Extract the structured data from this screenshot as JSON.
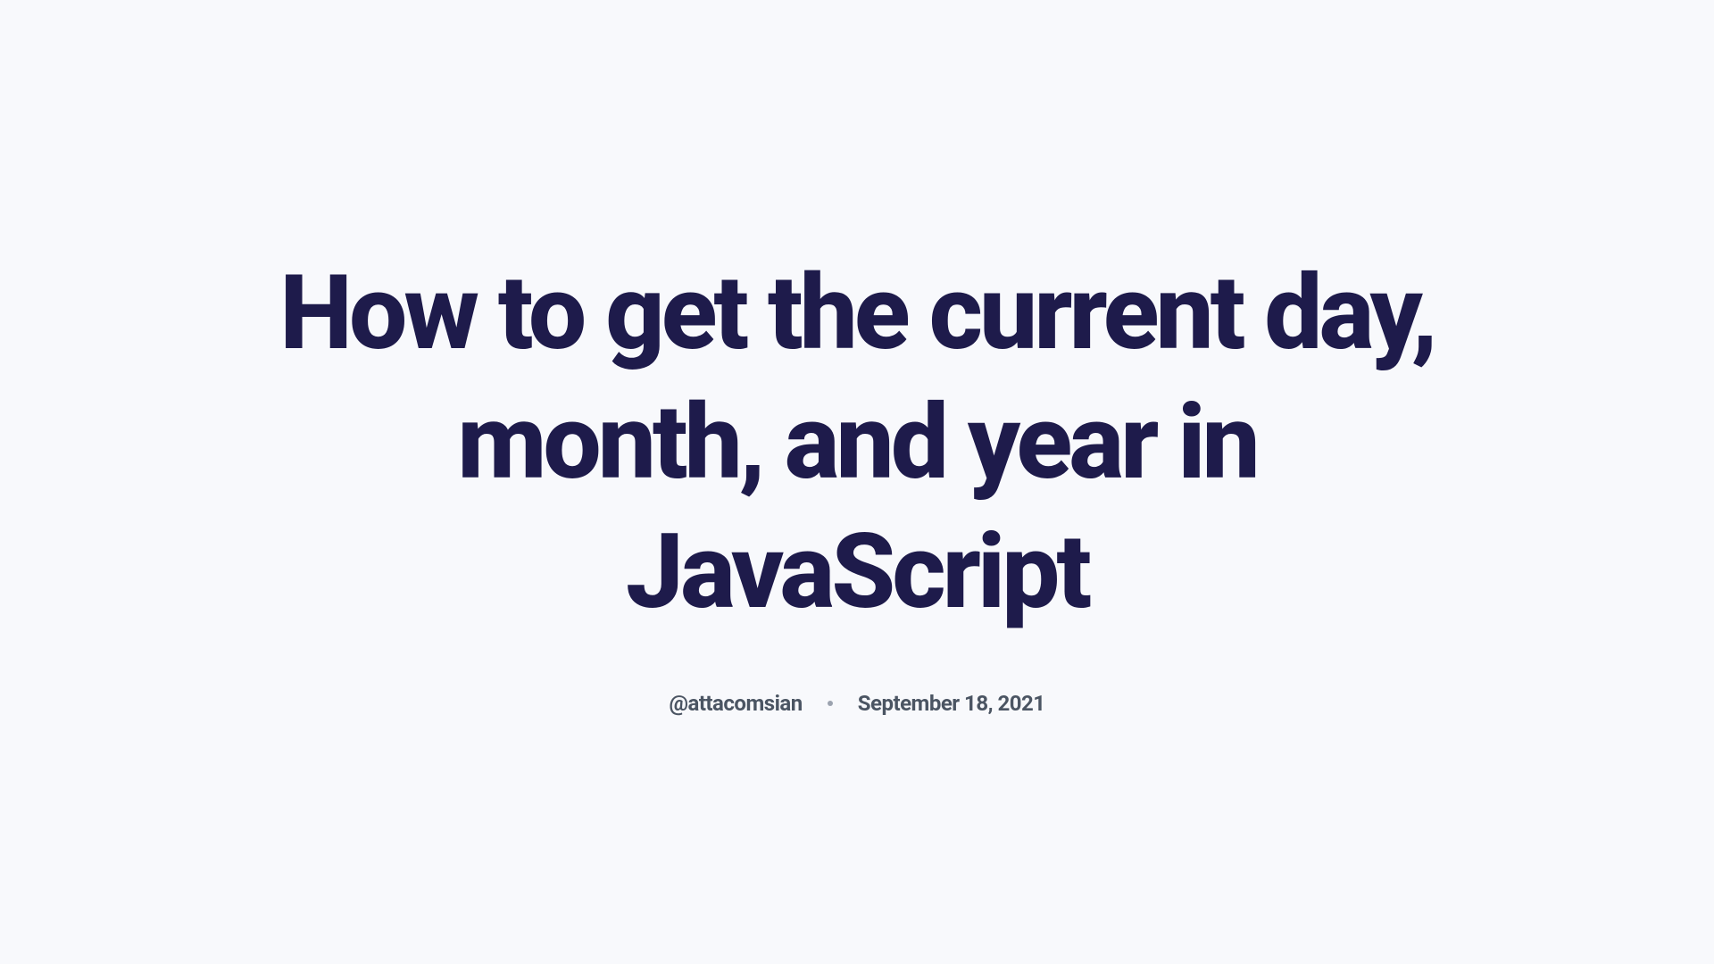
{
  "article": {
    "title": "How to get the current day, month, and year in JavaScript",
    "author": "@attacomsian",
    "date": "September 18, 2021"
  }
}
